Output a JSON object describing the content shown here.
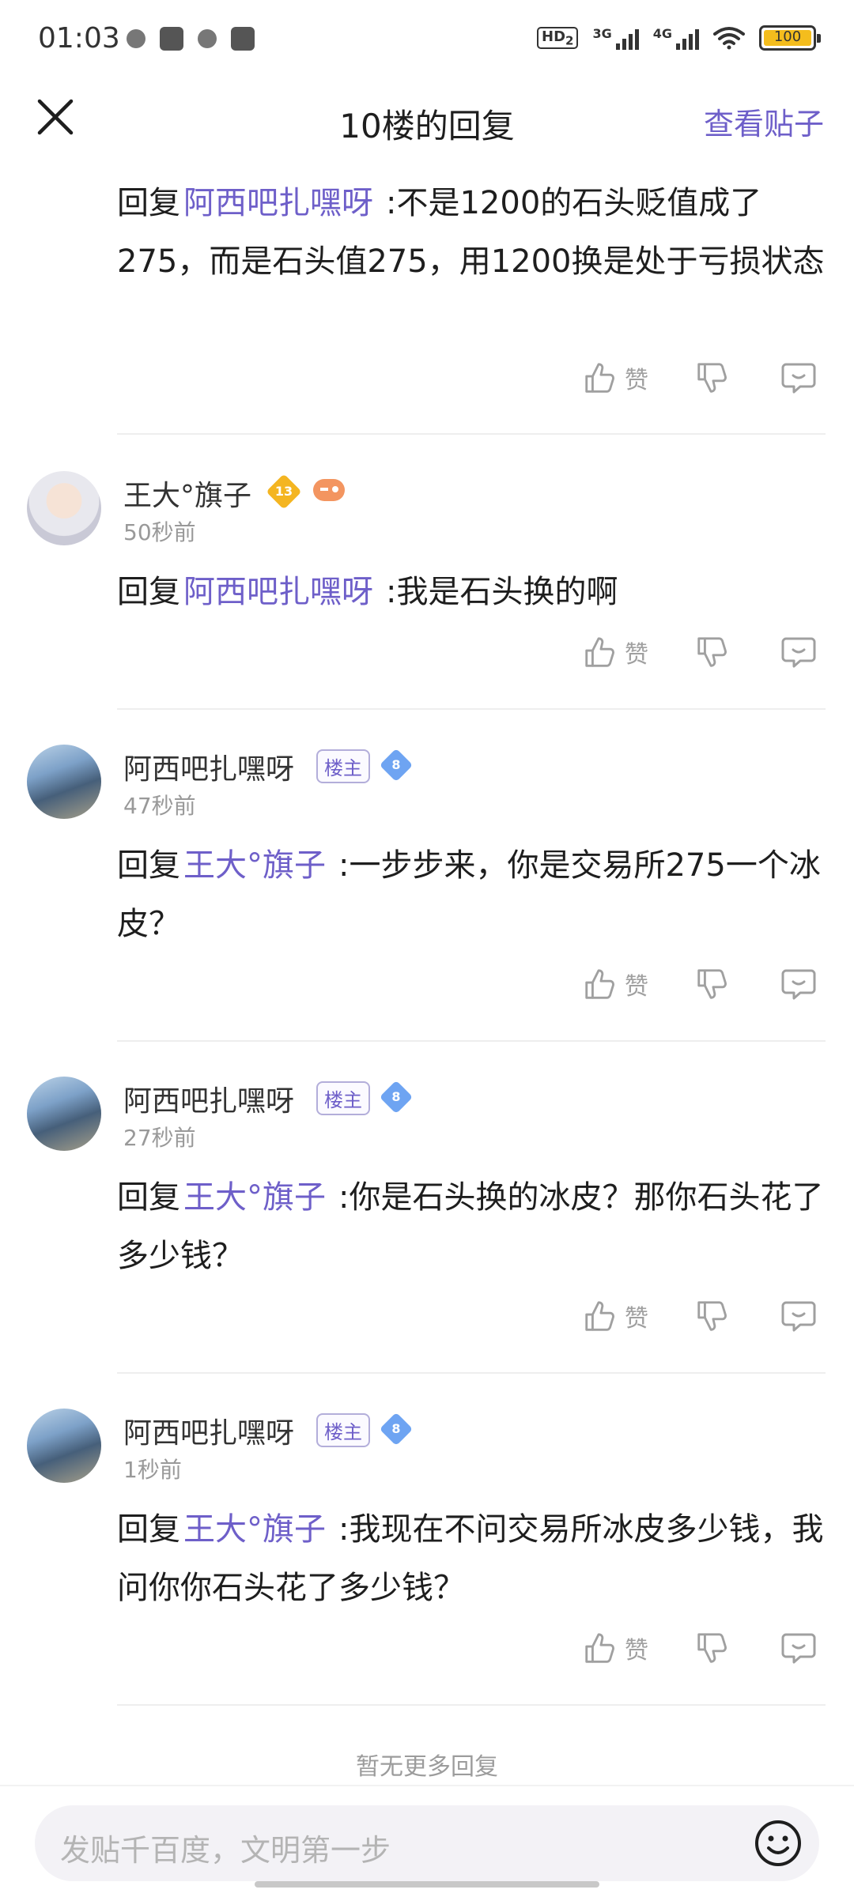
{
  "status_bar": {
    "time": "01:03",
    "hd_label": "HD",
    "hd_sub": "2",
    "sig1_label": "3G",
    "sig2_label": "4G",
    "battery": "100"
  },
  "header": {
    "title": "10楼的回复",
    "view_post": "查看贴子"
  },
  "comments": [
    {
      "reply_prefix": "回复",
      "reply_to": "阿西吧扎嘿呀",
      "text": ":不是1200的石头贬值成了275，而是石头值275，用1200换是处于亏损状态",
      "like_label": "赞"
    },
    {
      "username": "王大°旗子",
      "level": "13",
      "time": "50秒前",
      "reply_prefix": "回复",
      "reply_to": "阿西吧扎嘿呀",
      "text": ":我是石头换的啊",
      "like_label": "赞"
    },
    {
      "username": "阿西吧扎嘿呀",
      "badge": "楼主",
      "level": "8",
      "time": "47秒前",
      "reply_prefix": "回复",
      "reply_to": "王大°旗子",
      "text": ":一步步来，你是交易所275一个冰皮？",
      "like_label": "赞"
    },
    {
      "username": "阿西吧扎嘿呀",
      "badge": "楼主",
      "level": "8",
      "time": "27秒前",
      "reply_prefix": "回复",
      "reply_to": "王大°旗子",
      "text": ":你是石头换的冰皮？那你石头花了多少钱？",
      "like_label": "赞"
    },
    {
      "username": "阿西吧扎嘿呀",
      "badge": "楼主",
      "level": "8",
      "time": "1秒前",
      "reply_prefix": "回复",
      "reply_to": "王大°旗子",
      "text": ":我现在不问交易所冰皮多少钱，我问你你石头花了多少钱？",
      "like_label": "赞"
    }
  ],
  "no_more": "暂无更多回复",
  "input": {
    "placeholder": "发贴千百度，文明第一步"
  },
  "colors": {
    "accent": "#6e5fc9",
    "text": "#1e1e1e",
    "muted": "#999999"
  }
}
